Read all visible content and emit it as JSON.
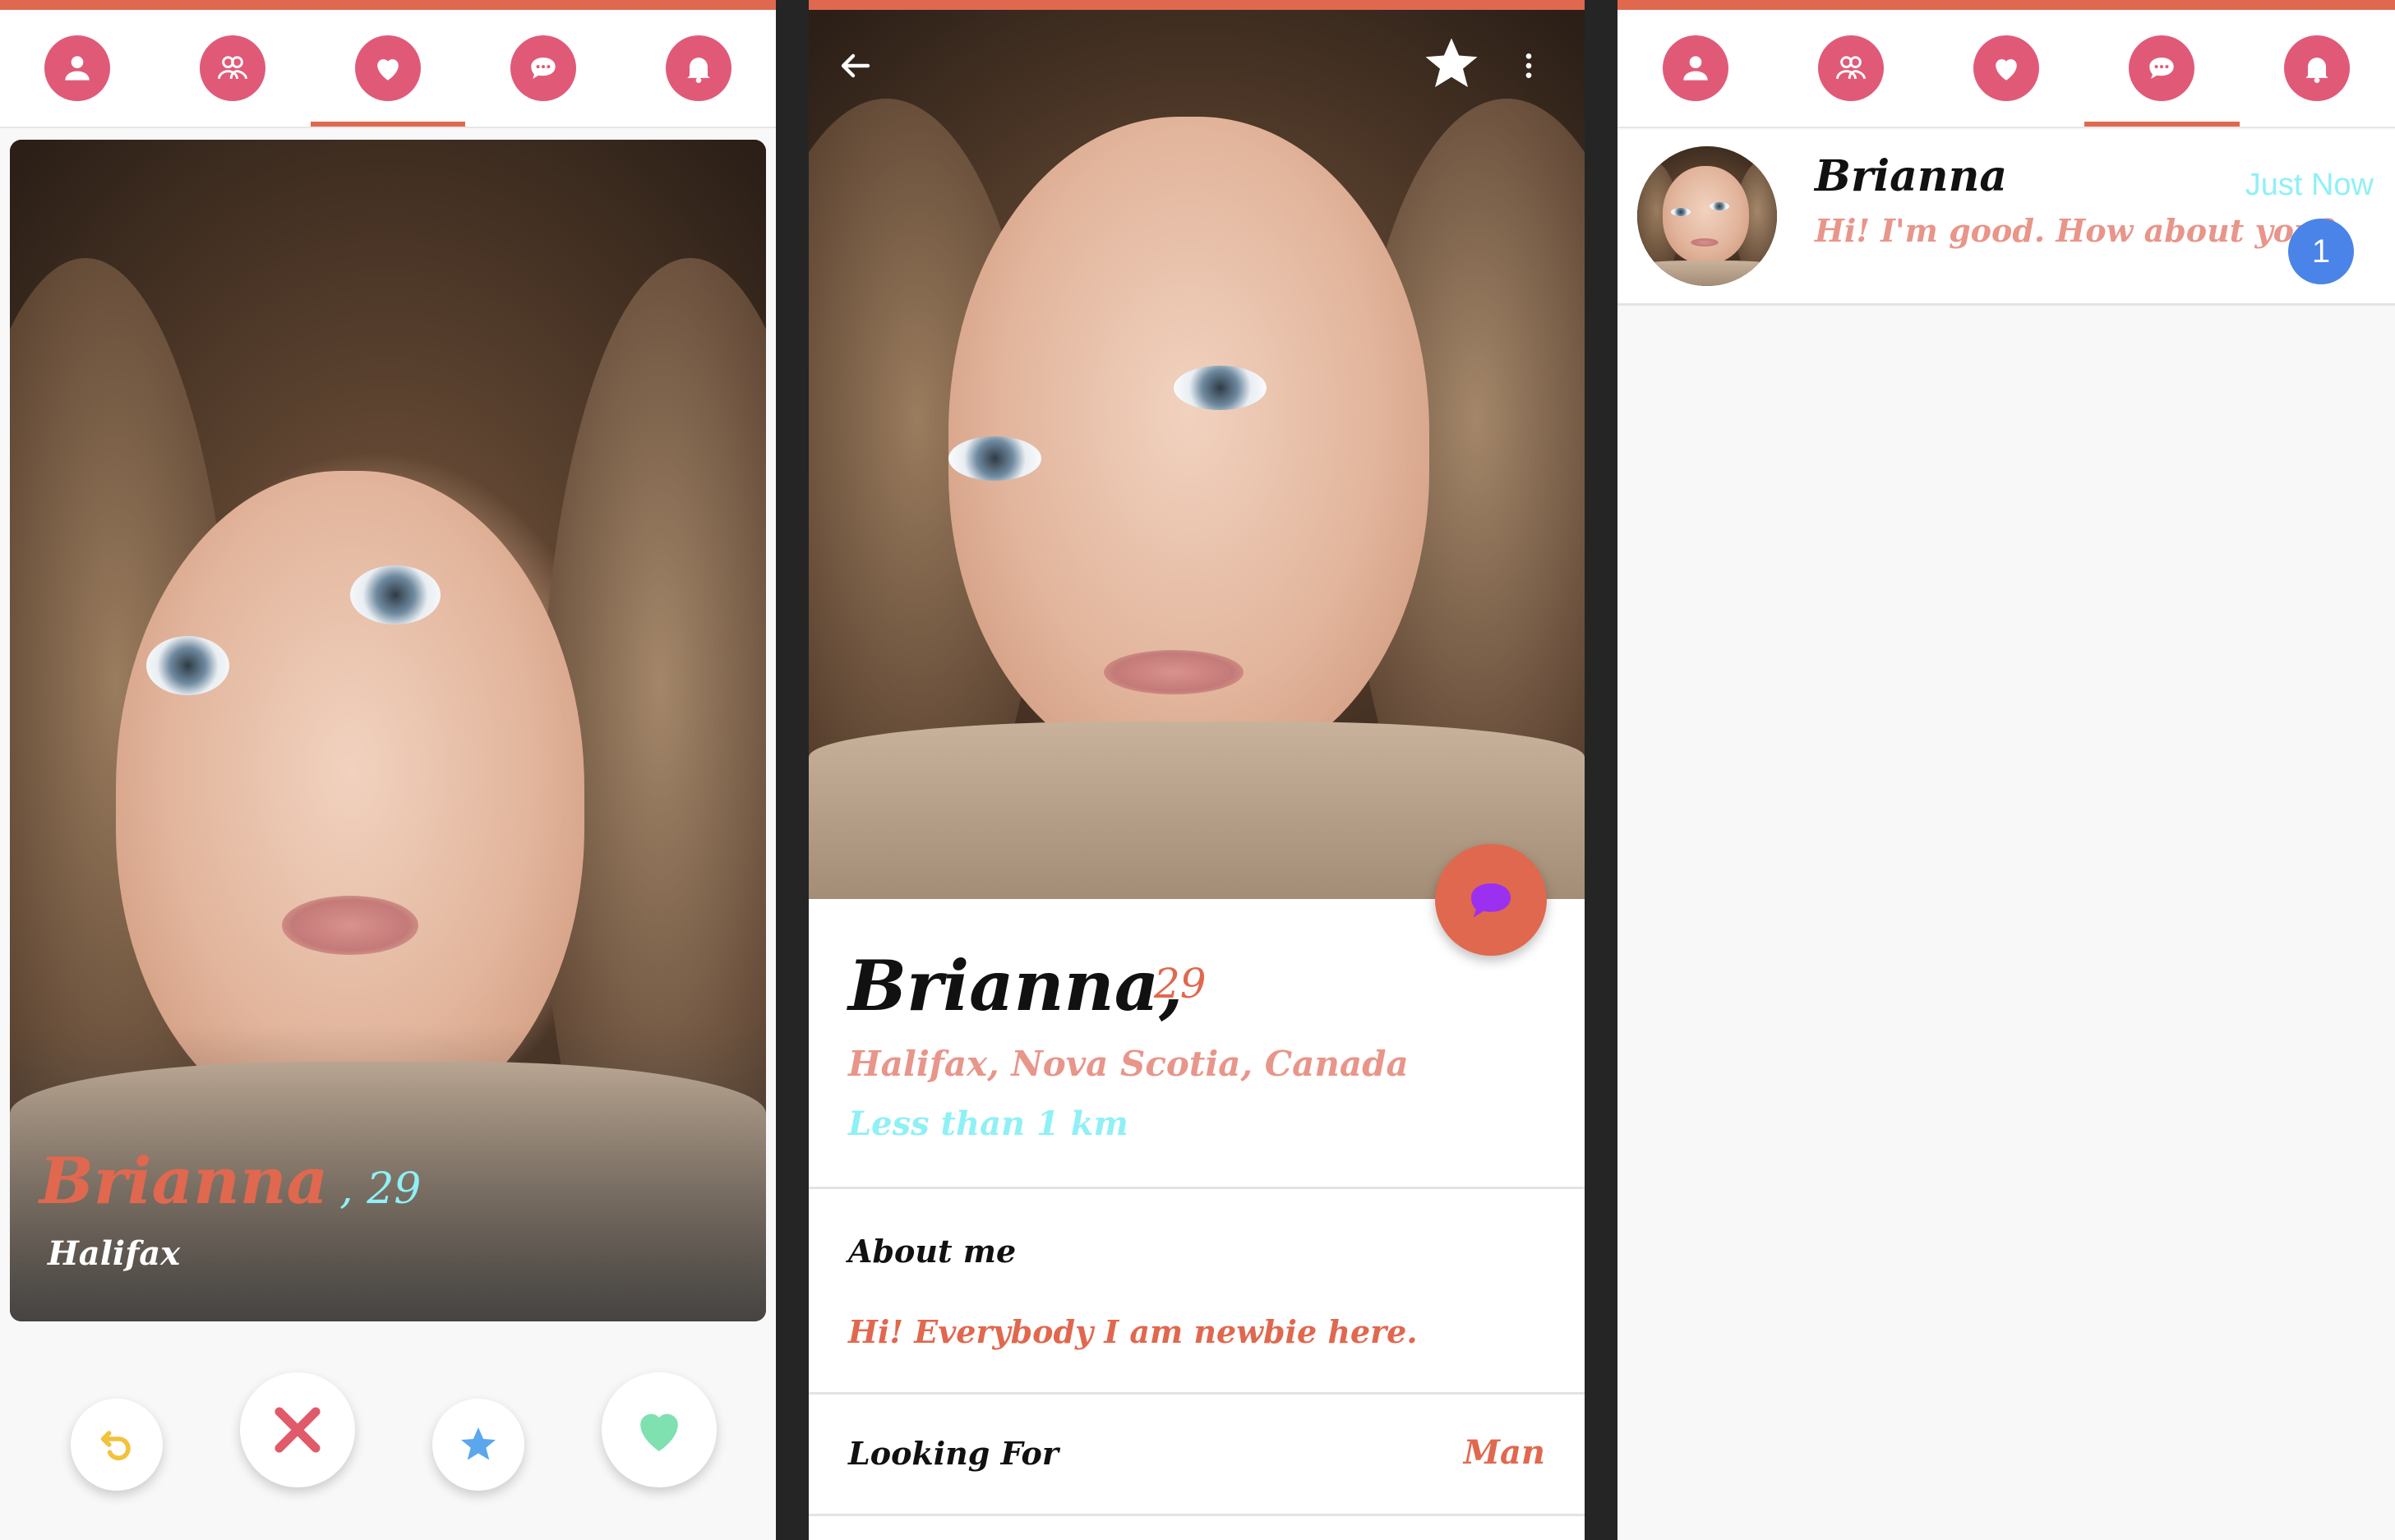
{
  "colors": {
    "accent": "#e0684e",
    "tab_icon_bg": "#e05a78",
    "name_cyan": "#8ff0f6",
    "location_pink": "#e8958a",
    "badge_blue": "#4a84e8",
    "like_green": "#7fe0b0",
    "undo_yellow": "#f2c23c",
    "star_blue": "#5aa7ee",
    "chat_fab_icon": "#9b30f0"
  },
  "tabs": [
    {
      "icon": "user-icon"
    },
    {
      "icon": "people-icon"
    },
    {
      "icon": "heart-icon"
    },
    {
      "icon": "chat-icon"
    },
    {
      "icon": "bell-icon"
    }
  ],
  "discover": {
    "active_tab": "heart-icon",
    "card": {
      "name": "Brianna",
      "age": ", 29",
      "city": "Halifax"
    },
    "actions": [
      {
        "icon": "undo-icon"
      },
      {
        "icon": "dislike-icon"
      },
      {
        "icon": "star-icon"
      },
      {
        "icon": "like-icon"
      }
    ]
  },
  "profile": {
    "header_icons": [
      "back-arrow-icon",
      "favorite-star-icon",
      "more-vert-icon"
    ],
    "name": "Brianna,",
    "age": "29",
    "location": "Halifax, Nova Scotia, Canada",
    "distance": "Less than 1 km",
    "about_title": "About me",
    "about_text": "Hi! Everybody I am newbie here.",
    "looking_for_label": "Looking For",
    "looking_for_value": "Man"
  },
  "messages": {
    "active_tab": "chat-icon",
    "items": [
      {
        "name": "Brianna",
        "time": "Just Now",
        "text": "Hi! I'm good. How about you?",
        "unread": "1"
      }
    ]
  }
}
